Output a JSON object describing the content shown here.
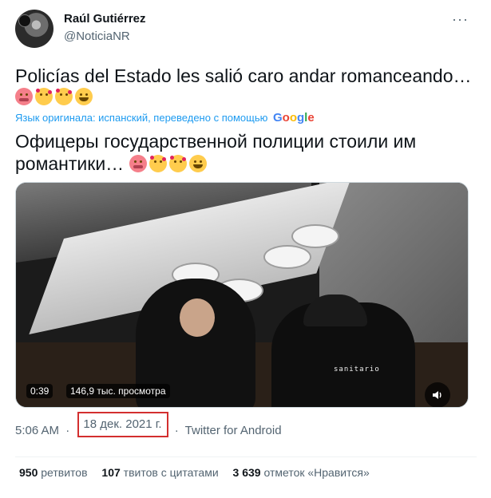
{
  "author": {
    "name": "Raúl Gutiérrez",
    "handle": "@NoticiaNR"
  },
  "more_menu": "···",
  "tweet": {
    "original_text": "Policías del Estado les salió caro andar romanceando…",
    "emojis": [
      "hot-face",
      "smiling-face-with-hearts",
      "smiling-face-with-hearts",
      "face-with-tears-of-joy"
    ],
    "translation_note": "Язык оригинала: испанский, переведено с помощью",
    "translation_provider": "Google",
    "translated_text": "Офицеры государственной полиции стоили им романтики…"
  },
  "video": {
    "duration": "0:39",
    "views": "146,9 тыс. просмотра",
    "overlay_text": "sanitario"
  },
  "meta": {
    "time": "5:06 AM",
    "date": "18 дек. 2021 г.",
    "separator": "·",
    "source": "Twitter for Android",
    "highlight_color": "#d32f2f"
  },
  "stats": {
    "retweets_count": "950",
    "retweets_label": "ретвитов",
    "quotes_count": "107",
    "quotes_label": "твитов с цитатами",
    "likes_count": "3 639",
    "likes_label": "отметок «Нравится»"
  },
  "colors": {
    "link": "#1d9bf0",
    "muted": "#536471",
    "text": "#0f1419"
  }
}
